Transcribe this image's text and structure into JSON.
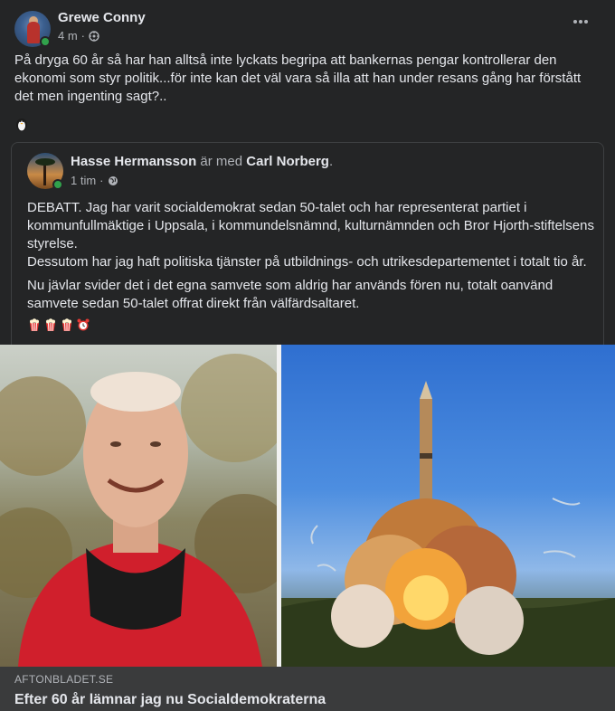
{
  "post": {
    "author": "Grewe Conny",
    "time": "4 m",
    "separator": "·",
    "more_icon": "more-horizontal-icon",
    "text": "På dryga 60 år så har han alltså inte lyckats begripa att bankernas pengar kontrollerar den ekonomi som styr politik...för inte kan det väl vara så illa att han under resans gång har förstått det men ingenting sagt?..",
    "emoji": "penguin-icon"
  },
  "shared_post": {
    "author": "Hasse Hermansson",
    "with_text": "är med",
    "tagged": "Carl Norberg",
    "tagged_suffix": ".",
    "time": "1 tim",
    "separator": "·",
    "paragraph1": "DEBATT. Jag har varit socialdemokrat sedan 50-talet och har representerat partiet i kommunfullmäktige i Uppsala, i kommundelsnämnd, kulturnämnden och Bror Hjorth-stiftelsens styrelse.",
    "paragraph2": "Dessutom har jag haft politiska tjänster på utbildnings- och utrikesdepartementet i totalt tio år.",
    "paragraph3": "Nu jävlar svider det i det egna samvete som aldrig har används fören nu, totalt oanvänd samvete sedan 50-talet offrat direkt från välfärdsaltaret.",
    "emojis": [
      "popcorn-icon",
      "popcorn-icon",
      "popcorn-icon",
      "alarm-clock-icon"
    ]
  },
  "link": {
    "domain": "AFTONBLADET.SE",
    "title": "Efter 60 år lämnar jag nu Socialdemokraterna"
  },
  "colors": {
    "background": "#242526",
    "text_primary": "#e4e6eb",
    "text_secondary": "#b0b3b8",
    "online": "#31a24c",
    "link_footer": "#3a3b3c"
  }
}
